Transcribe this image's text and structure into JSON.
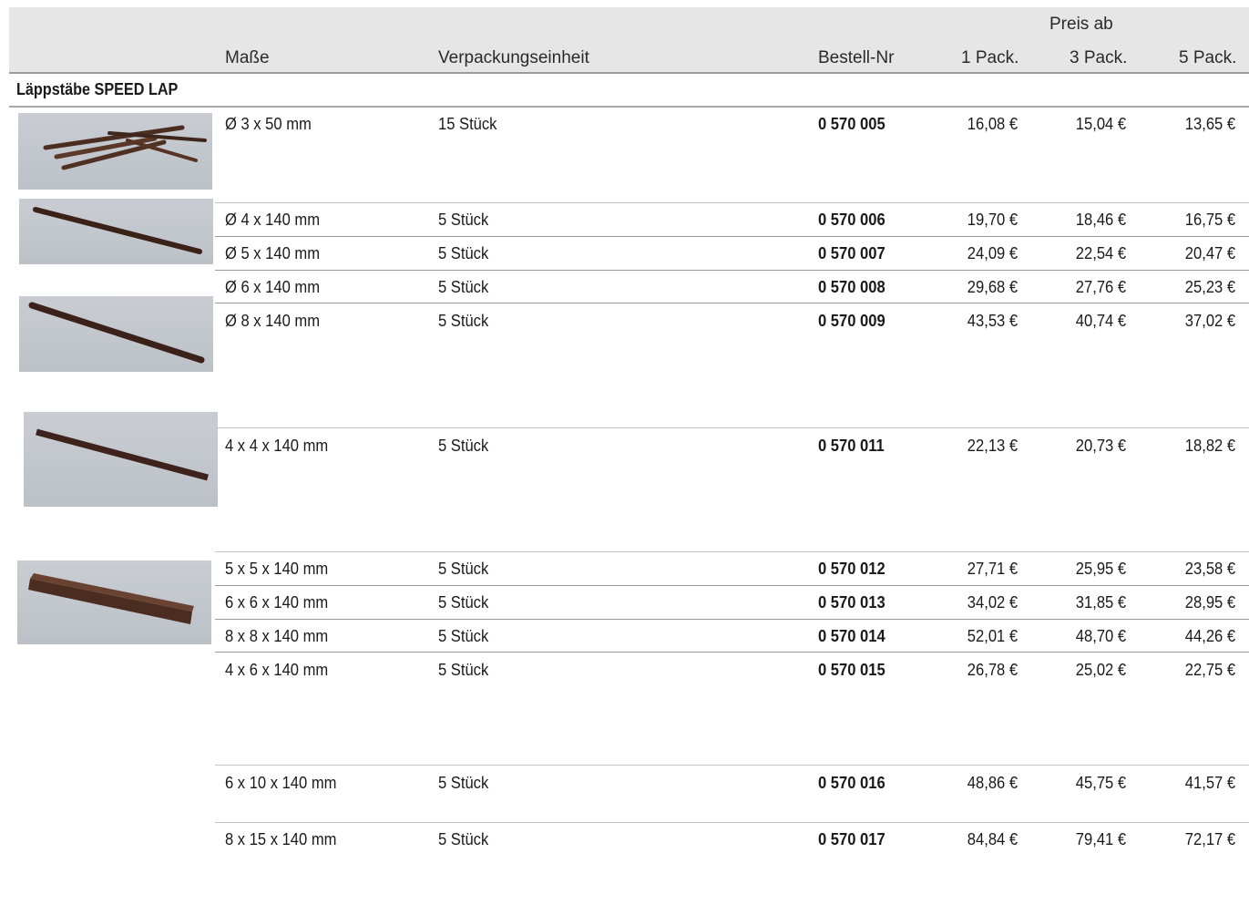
{
  "header": {
    "price_group": "Preis ab",
    "col_dim": "Maße",
    "col_pack": "Verpackungseinheit",
    "col_order": "Bestell-Nr",
    "col_p1": "1 Pack.",
    "col_p3": "3 Pack.",
    "col_p5": "5 Pack."
  },
  "section": {
    "title": "Läppstäbe SPEED LAP"
  },
  "rows": [
    {
      "dim": "Ø 3 x 50 mm",
      "pack": "15 Stück",
      "order": "0 570 005",
      "p1": "16,08 €",
      "p3": "15,04 €",
      "p5": "13,65 €"
    },
    {
      "dim": "Ø 4 x 140 mm",
      "pack": "5 Stück",
      "order": "0 570 006",
      "p1": "19,70 €",
      "p3": "18,46 €",
      "p5": "16,75 €"
    },
    {
      "dim": "Ø 5 x 140 mm",
      "pack": "5 Stück",
      "order": "0 570 007",
      "p1": "24,09 €",
      "p3": "22,54 €",
      "p5": "20,47 €"
    },
    {
      "dim": "Ø 6 x 140 mm",
      "pack": "5 Stück",
      "order": "0 570 008",
      "p1": "29,68 €",
      "p3": "27,76 €",
      "p5": "25,23 €"
    },
    {
      "dim": "Ø 8 x 140 mm",
      "pack": "5 Stück",
      "order": "0 570 009",
      "p1": "43,53 €",
      "p3": "40,74 €",
      "p5": "37,02 €"
    },
    {
      "dim": "4 x 4 x 140 mm",
      "pack": "5 Stück",
      "order": "0 570 011",
      "p1": "22,13 €",
      "p3": "20,73 €",
      "p5": "18,82 €"
    },
    {
      "dim": "5 x 5 x 140 mm",
      "pack": "5 Stück",
      "order": "0 570 012",
      "p1": "27,71 €",
      "p3": "25,95 €",
      "p5": "23,58 €"
    },
    {
      "dim": "6 x 6 x 140 mm",
      "pack": "5 Stück",
      "order": "0 570 013",
      "p1": "34,02 €",
      "p3": "31,85 €",
      "p5": "28,95 €"
    },
    {
      "dim": "8 x 8 x 140 mm",
      "pack": "5 Stück",
      "order": "0 570 014",
      "p1": "52,01 €",
      "p3": "48,70 €",
      "p5": "44,26 €"
    },
    {
      "dim": "4 x 6 x 140 mm",
      "pack": "5 Stück",
      "order": "0 570 015",
      "p1": "26,78 €",
      "p3": "25,02 €",
      "p5": "22,75 €"
    },
    {
      "dim": "6 x 10 x 140 mm",
      "pack": "5 Stück",
      "order": "0 570 016",
      "p1": "48,86 €",
      "p3": "45,75 €",
      "p5": "41,57 €"
    },
    {
      "dim": "8 x 15 x 140 mm",
      "pack": "5 Stück",
      "order": "0 570 017",
      "p1": "84,84 €",
      "p3": "79,41 €",
      "p5": "72,17 €"
    }
  ]
}
